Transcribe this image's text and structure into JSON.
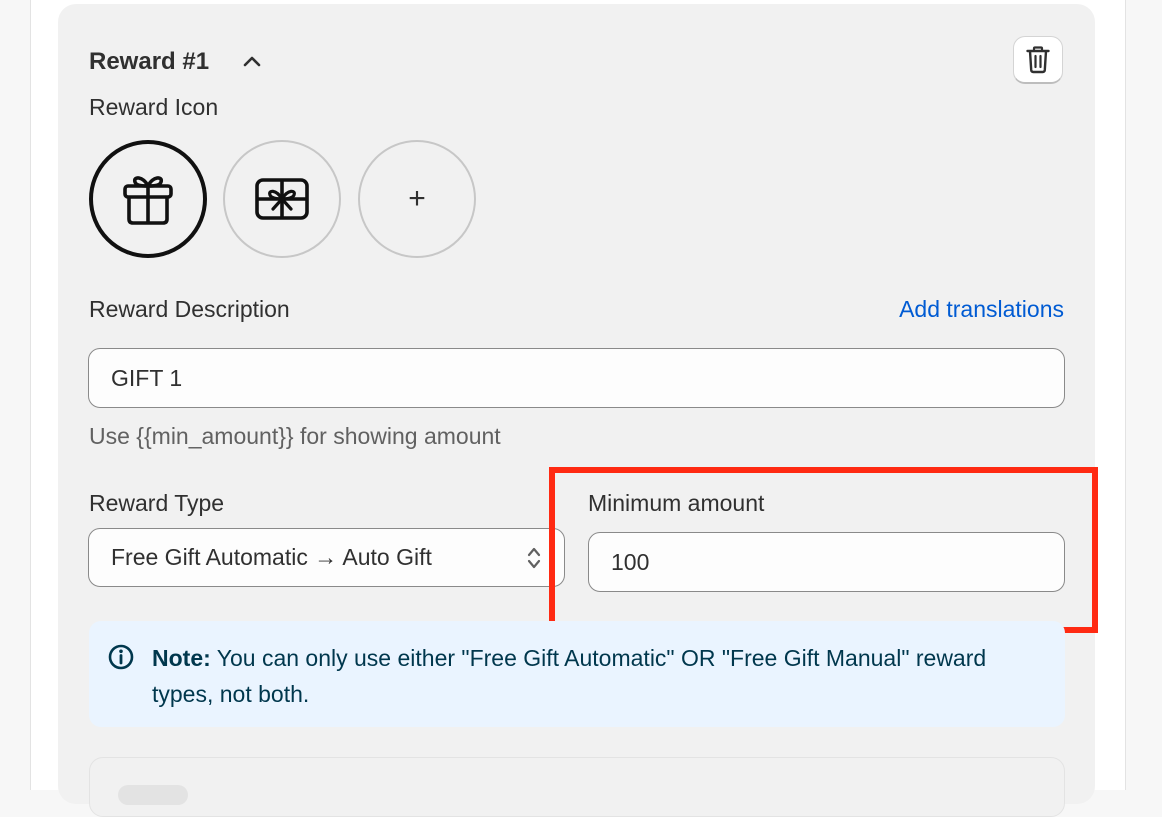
{
  "reward": {
    "title": "Reward #1",
    "collapse_icon": "chevron-up-icon",
    "delete_icon": "trash-icon"
  },
  "reward_icon": {
    "label": "Reward Icon",
    "options": [
      {
        "icon": "gift-icon",
        "selected": true
      },
      {
        "icon": "gift-card-icon",
        "selected": false
      }
    ],
    "add_label": "+"
  },
  "description": {
    "label": "Reward Description",
    "translations_link": "Add translations",
    "value": "GIFT 1",
    "help": "Use {{min_amount}} for showing amount"
  },
  "reward_type": {
    "label": "Reward Type",
    "selected": "Free Gift Automatic → Auto Gift"
  },
  "minimum_amount": {
    "label": "Minimum amount",
    "value": "100"
  },
  "note": {
    "icon": "info-icon",
    "prefix": "Note:",
    "text": " You can only use either \"Free Gift Automatic\" OR \"Free Gift Manual\" reward types, not both."
  },
  "colors": {
    "link": "#005bd3",
    "highlight": "#ff2a12",
    "banner_bg": "#eaf4ff",
    "banner_text": "#00374d"
  }
}
